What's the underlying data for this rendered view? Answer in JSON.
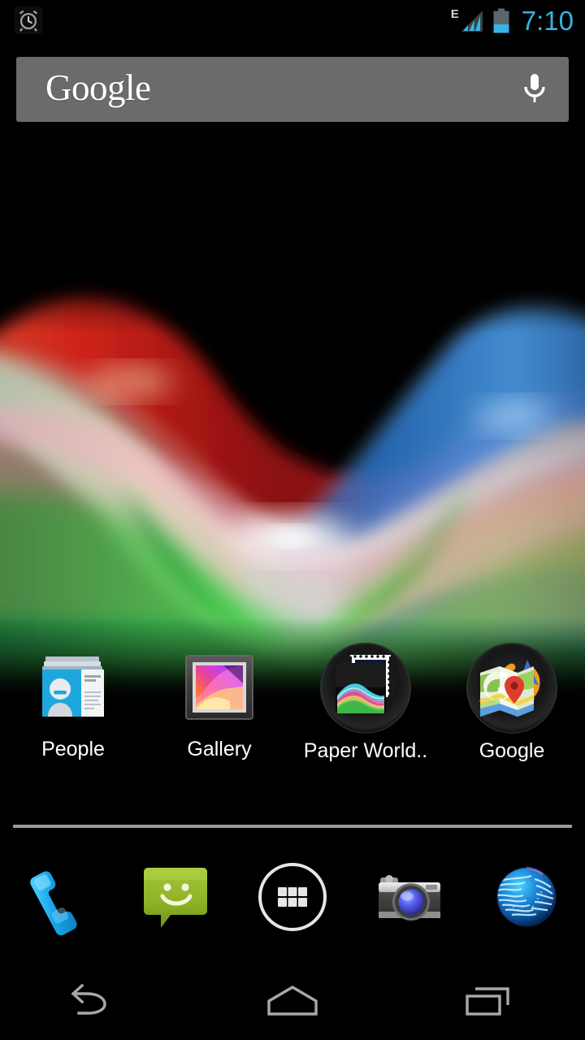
{
  "status_bar": {
    "alarm_icon": "alarm-clock-icon",
    "network_type": "E",
    "signal_icon": "signal-bars-icon",
    "signal_bars_filled": 3,
    "signal_bars_total": 4,
    "battery_icon": "battery-icon",
    "battery_level_percent": 40,
    "time": "7:10",
    "accent_color": "#33b5e5"
  },
  "search_widget": {
    "logo_text": "Google",
    "mic_icon": "microphone-icon",
    "background_color": "#6b6b6b"
  },
  "home_apps": [
    {
      "label": "People",
      "icon": "people-contacts-icon",
      "type": "app"
    },
    {
      "label": "Gallery",
      "icon": "gallery-photo-frame-icon",
      "type": "app"
    },
    {
      "label": "Paper World..",
      "icon": "paper-world-wallpaper-icon",
      "type": "folder"
    },
    {
      "label": "Google",
      "icon": "google-maps-folder-icon",
      "type": "folder"
    }
  ],
  "dock": {
    "items": [
      {
        "name": "Phone",
        "icon": "phone-handset-icon"
      },
      {
        "name": "Messaging",
        "icon": "messaging-smiley-icon"
      },
      {
        "name": "Apps",
        "icon": "app-drawer-grid-icon"
      },
      {
        "name": "Camera",
        "icon": "camera-icon"
      },
      {
        "name": "Browser",
        "icon": "browser-globe-icon"
      }
    ]
  },
  "nav_bar": {
    "items": [
      {
        "name": "Back",
        "icon": "back-arrow-icon"
      },
      {
        "name": "Home",
        "icon": "home-pentagon-icon"
      },
      {
        "name": "Recents",
        "icon": "recent-apps-icon"
      }
    ]
  },
  "wallpaper": {
    "name": "Phase Beam live wallpaper",
    "background_color": "#000000",
    "beam_colors": [
      "#cc2222",
      "#2277dd",
      "#33cc44",
      "#44ddcc",
      "#ffddaa",
      "#dd55aa"
    ]
  }
}
